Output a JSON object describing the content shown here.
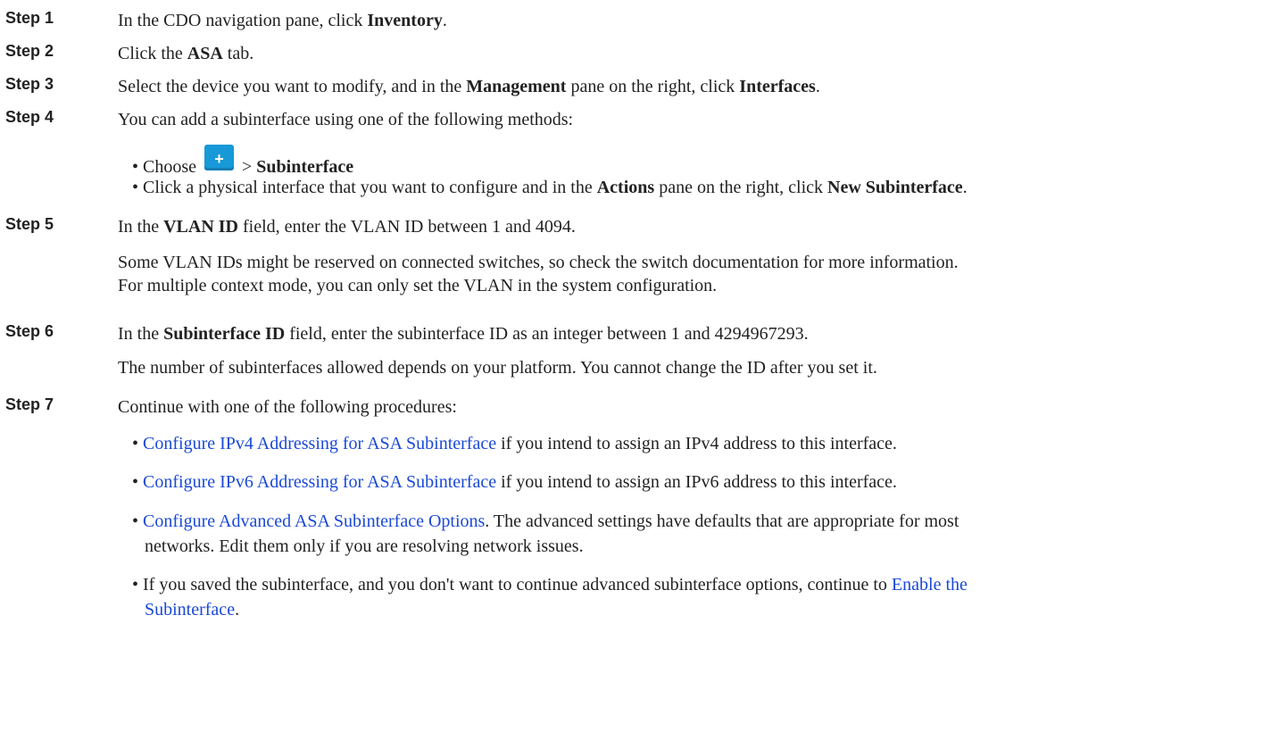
{
  "steps": [
    {
      "label": "Step 1",
      "pre": "In the CDO navigation pane, click ",
      "b1": "Inventory",
      "post": "."
    },
    {
      "label": "Step 2",
      "pre": "Click the ",
      "b1": "ASA",
      "post": " tab."
    },
    {
      "label": "Step 3",
      "pre": "Select the device you want to modify, and in the ",
      "b1": "Management",
      "mid": " pane on the right, click ",
      "b2": "Interfaces",
      "post": "."
    },
    {
      "label": "Step 4",
      "text": "You can add a subinterface using one of the following methods:"
    },
    {
      "label": "Step 5",
      "pre": "In the ",
      "b1": "VLAN ID",
      "post": " field, enter the VLAN ID between 1 and 4094."
    },
    {
      "label": "Step 6",
      "pre": "In the ",
      "b1": "Subinterface ID",
      "post": " field, enter the subinterface ID as an integer between 1 and 4294967293."
    },
    {
      "label": "Step 7",
      "text": "Continue with one of the following procedures:"
    }
  ],
  "step4_bullets": {
    "b1_pre": "• Choose ",
    "b1_sep": " > ",
    "b1_bold": "Subinterface",
    "b2_pre": "• Click a physical interface that you want to configure and in the ",
    "b2_bold1": "Actions",
    "b2_mid": " pane on the right, click ",
    "b2_bold2": "New Subinterface",
    "b2_post": "."
  },
  "plus_icon_glyph": "+",
  "step5_para": {
    "line1": "Some VLAN IDs might be reserved on connected switches, so check the switch documentation for more information.",
    "line2": "For multiple context mode, you can only set the VLAN in the system configuration."
  },
  "step6_para": "The number of subinterfaces allowed depends on your platform. You cannot change the ID after you set it.",
  "step7_bullets": {
    "i1_link": "Configure IPv4 Addressing for ASA Subinterface",
    "i1_text": " if you intend to assign an IPv4 address to this interface.",
    "i2_link": "Configure IPv6 Addressing for ASA Subinterface",
    "i2_text": " if you intend to assign an IPv6 address to this interface.",
    "i3_link": "Configure Advanced ASA Subinterface Options",
    "i3_text1": ". The advanced settings have defaults that are appropriate for most",
    "i3_text2": "networks. Edit them only if you are resolving network issues.",
    "i4_text": "If you saved the subinterface, and you don't want to continue advanced subinterface options, continue to ",
    "i4_link1": "Enable the",
    "i4_link2": "Subinterface",
    "i4_post": "."
  },
  "bullet_char": "•",
  "colors": {
    "link": "#1a49d6",
    "plus_button": "#1799d8"
  }
}
